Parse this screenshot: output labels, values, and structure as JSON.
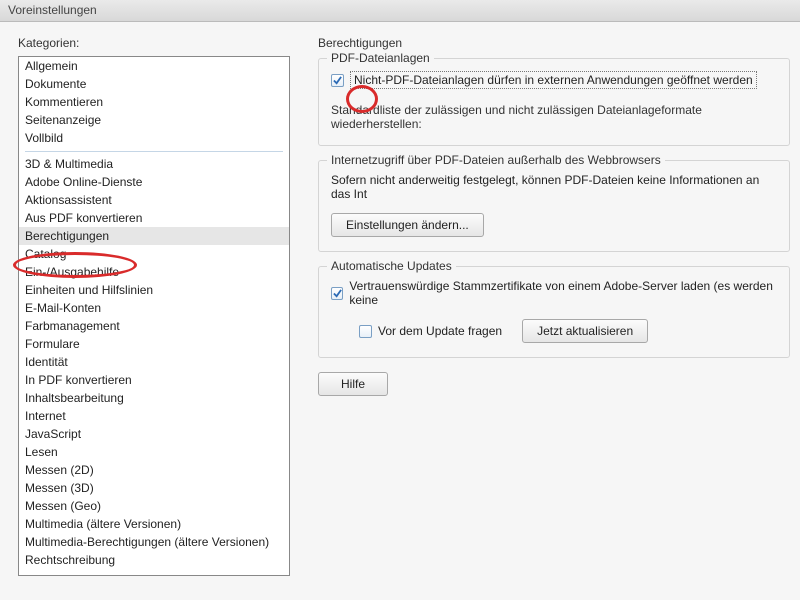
{
  "window": {
    "title": "Voreinstellungen"
  },
  "left": {
    "label": "Kategorien:",
    "group1": [
      "Allgemein",
      "Dokumente",
      "Kommentieren",
      "Seitenanzeige",
      "Vollbild"
    ],
    "group2": [
      "3D & Multimedia",
      "Adobe Online-Dienste",
      "Aktionsassistent",
      "Aus PDF konvertieren",
      "Berechtigungen",
      "Catalog",
      "Ein-/Ausgabehilfe",
      "Einheiten und Hilfslinien",
      "E-Mail-Konten",
      "Farbmanagement",
      "Formulare",
      "Identität",
      "In PDF konvertieren",
      "Inhaltsbearbeitung",
      "Internet",
      "JavaScript",
      "Lesen",
      "Messen (2D)",
      "Messen (3D)",
      "Messen (Geo)",
      "Multimedia (ältere Versionen)",
      "Multimedia-Berechtigungen (ältere Versionen)",
      "Rechtschreibung"
    ],
    "selected": "Berechtigungen"
  },
  "right": {
    "title": "Berechtigungen",
    "group_attachments": {
      "legend": "PDF-Dateianlagen",
      "chk_external_label": "Nicht-PDF-Dateianlagen dürfen in externen Anwendungen geöffnet werden",
      "chk_external_checked": true,
      "restore_text": "Standardliste der zulässigen und nicht zulässigen Dateianlageformate wiederherstellen:"
    },
    "group_internet": {
      "legend": "Internetzugriff über PDF-Dateien außerhalb des Webbrowsers",
      "info_text": "Sofern nicht anderweitig festgelegt, können PDF-Dateien keine Informationen an das Int",
      "btn_settings": "Einstellungen ändern..."
    },
    "group_updates": {
      "legend": "Automatische Updates",
      "chk_trusted_label": "Vertrauenswürdige Stammzertifikate von einem Adobe-Server laden (es werden keine",
      "chk_trusted_checked": true,
      "chk_ask_label": "Vor dem Update fragen",
      "chk_ask_checked": false,
      "btn_update": "Jetzt aktualisieren"
    },
    "btn_help": "Hilfe"
  }
}
